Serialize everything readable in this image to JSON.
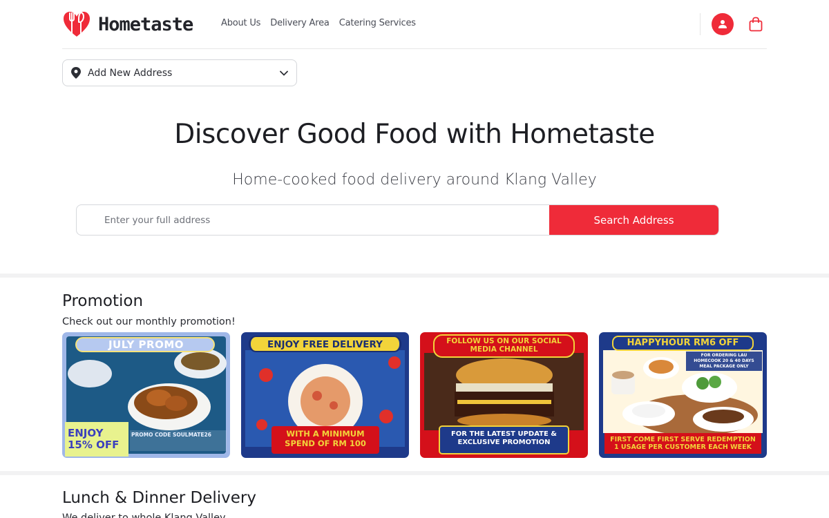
{
  "brand": {
    "name": "Hometaste",
    "accent": "#ef2b39"
  },
  "nav": {
    "items": [
      "About Us",
      "Delivery Area",
      "Catering Services"
    ]
  },
  "header": {
    "user_icon": "user-icon",
    "cart_icon": "shopping-bag-icon"
  },
  "address_select": {
    "value": "Add New Address",
    "icon": "location-pin-icon"
  },
  "hero": {
    "title": "Discover Good Food with Hometaste",
    "subtitle": "Home-cooked food delivery around Klang Valley",
    "search_placeholder": "Enter your full address",
    "search_button": "Search Address"
  },
  "promotion": {
    "title": "Promotion",
    "subtitle": "Check out our monthly promotion!",
    "cards": [
      {
        "top": "JULY PROMO",
        "bottom": "ENJOY 15% OFF",
        "extra": "PROMO CODE SOULMATE26",
        "colors": [
          "#9fb7e8",
          "#1e3f78"
        ]
      },
      {
        "top": "ENJOY FREE DELIVERY",
        "bottom": "WITH A MINIMUM SPEND OF RM 100",
        "colors": [
          "#1e3a8a",
          "#2b4fa6"
        ]
      },
      {
        "top": "FOLLOW US ON OUR SOCIAL MEDIA CHANNEL",
        "bottom": "FOR THE LATEST UPDATE & EXCLUSIVE PROMOTION",
        "colors": [
          "#d4101a",
          "#8a0a10"
        ]
      },
      {
        "top": "HAPPYHOUR RM6 OFF",
        "bottom": "FIRST COME FIRST SERVE REDEMPTION 1 USAGE PER CUSTOMER EACH WEEK",
        "extra": "FOR ORDERING LAU HOMECOOK 20 & 40 DAYS MEAL PACKAGE ONLY",
        "colors": [
          "#1e3a8a",
          "#fff6e0"
        ]
      }
    ]
  },
  "lunch": {
    "title": "Lunch & Dinner Delivery",
    "subtitle": "We deliver to whole Klang Valley"
  }
}
